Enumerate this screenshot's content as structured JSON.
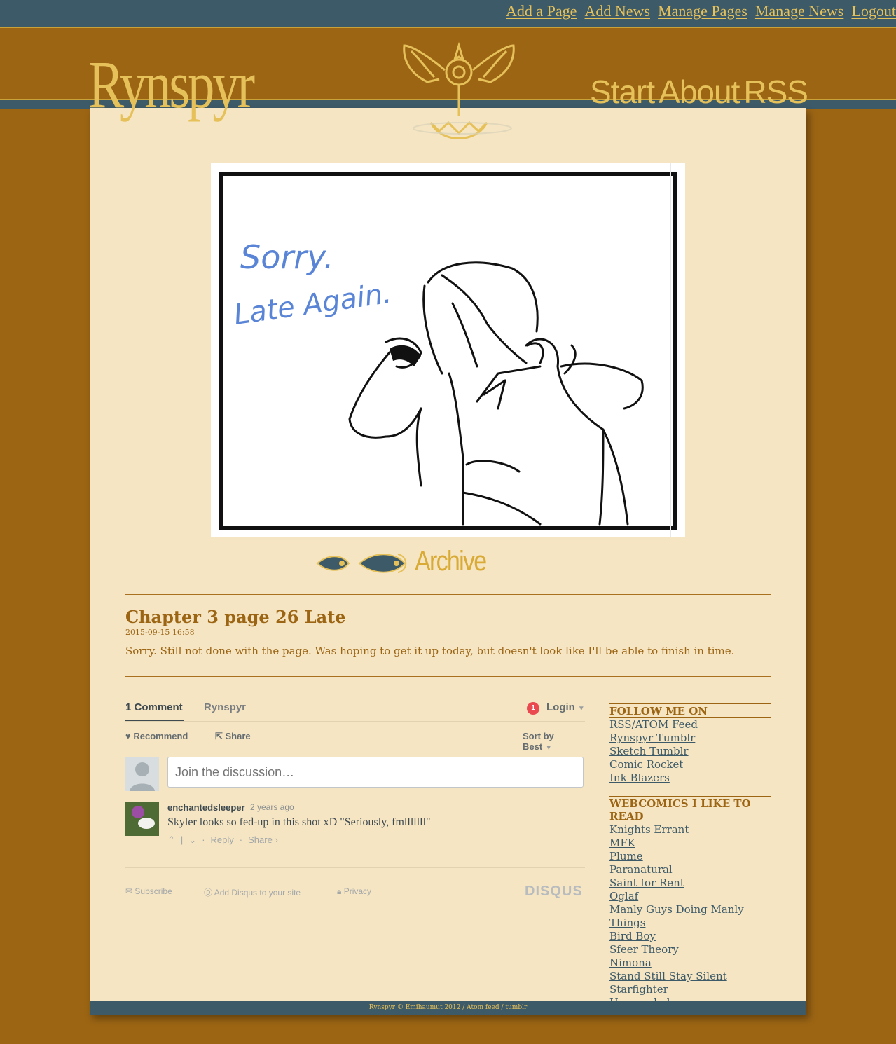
{
  "admin_nav": [
    "Add a Page",
    "Add News",
    "Manage Pages",
    "Manage News",
    "Logout"
  ],
  "site": {
    "logo": "Rynspyr",
    "nav": [
      "Start",
      "About",
      "RSS"
    ]
  },
  "comic": {
    "text_line1": "Sorry.",
    "text_line2": "Late Again.",
    "archive_label": "Archive"
  },
  "post": {
    "title": "Chapter 3 page 26 Late",
    "date": "2015-09-15 16:58",
    "body": "Sorry. Still not done with the page. Was hoping to get it up today, but doesn't look like I'll be able to finish in time."
  },
  "comments": {
    "count_tab": "1 Comment",
    "site_tab": "Rynspyr",
    "login_badge": "1",
    "login_label": "Login",
    "recommend_label": "Recommend",
    "share_label": "Share",
    "sort_label": "Sort by Best",
    "composer_placeholder": "Join the discussion…",
    "item": {
      "author": "enchantedsleeper",
      "time": "2 years ago",
      "text": "Skyler looks so fed-up in this shot xD \"Seriously, fmlllllll\"",
      "reply_label": "Reply",
      "share_label": "Share ›"
    },
    "footer": {
      "subscribe": "Subscribe",
      "add_disqus": "Add Disqus to your site",
      "privacy": "Privacy",
      "brand": "DISQUS"
    }
  },
  "sidebar": {
    "follow_heading": "FOLLOW ME ON",
    "follow_links": [
      "RSS/ATOM Feed",
      "Rynspyr Tumblr",
      "Sketch Tumblr",
      "Comic Rocket",
      "Ink Blazers"
    ],
    "webcomics_heading": "WEBCOMICS I LIKE TO READ",
    "webcomics_links": [
      "Knights Errant",
      "MFK",
      "Plume",
      "Paranatural",
      "Saint for Rent",
      "Oglaf",
      "Manly Guys Doing Manly Things",
      "Bird Boy",
      "Sfeer Theory",
      "Nimona",
      "Stand Still Stay Silent",
      "Starfighter",
      "Unsounded"
    ]
  },
  "footer_text": "Rynspyr © Emihaumut 2012 / Atom feed / tumblr",
  "colors": {
    "background": "#9c6514",
    "bar": "#3d5a68",
    "gold": "#e6c15a",
    "panel": "#f5e5c3"
  }
}
